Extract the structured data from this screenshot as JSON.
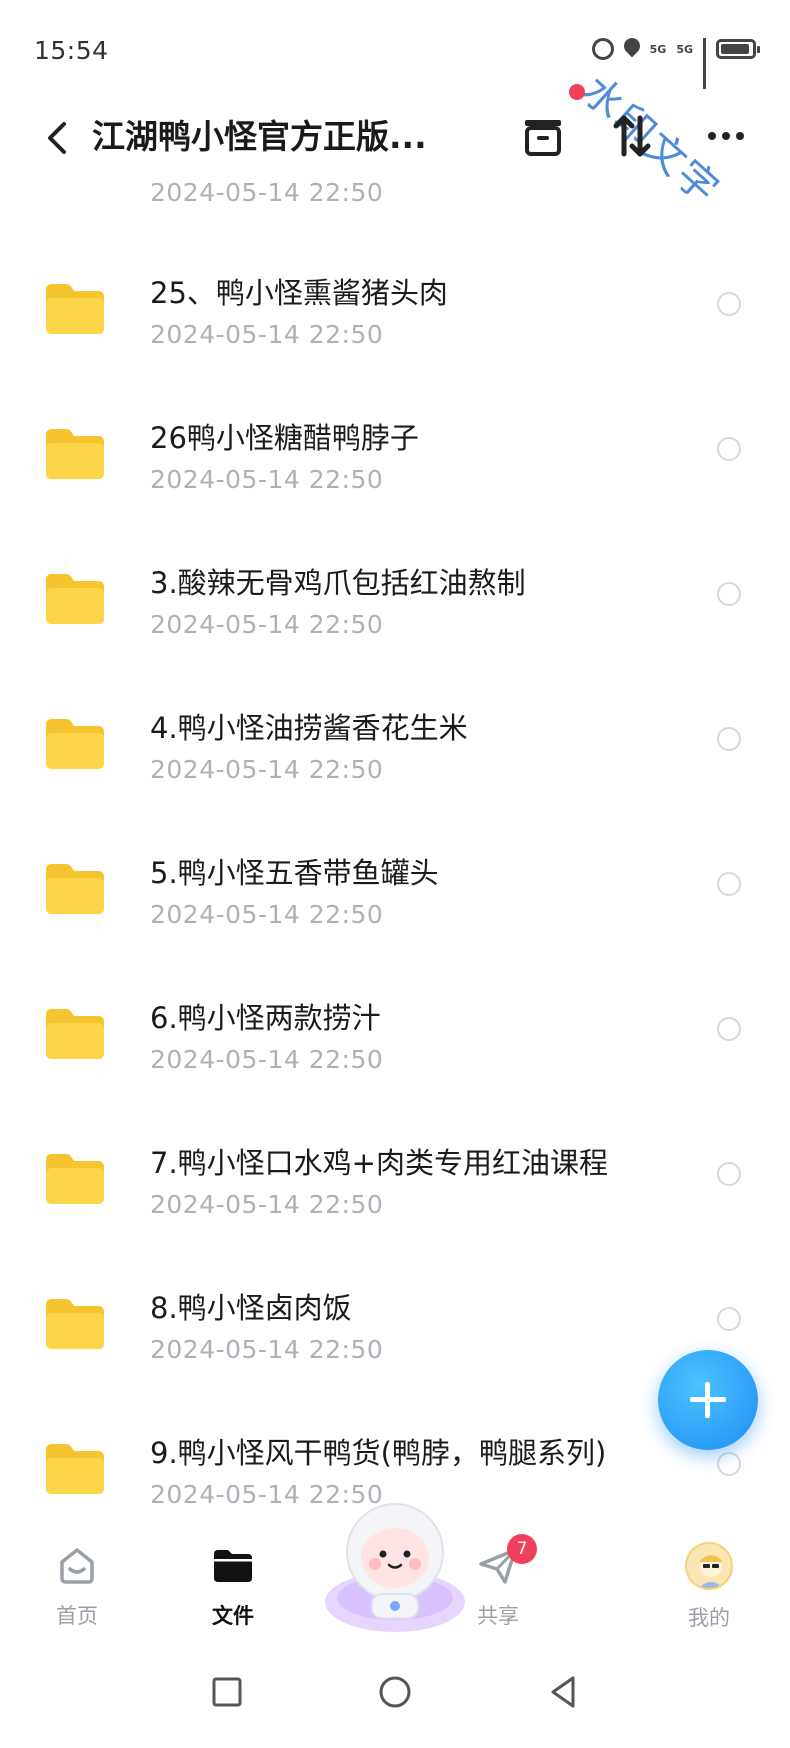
{
  "status_bar": {
    "time": "15:54",
    "signal_label_1": "5G",
    "signal_label_2": "5G"
  },
  "watermark": "水印文字",
  "header": {
    "title": "江湖鸭小怪官方正版..."
  },
  "partial_row": {
    "date": "2024-05-14  22:50"
  },
  "files": [
    {
      "name": "25、鸭小怪熏酱猪头肉",
      "date": "2024-05-14  22:50"
    },
    {
      "name": "26鸭小怪糖醋鸭脖子",
      "date": "2024-05-14  22:50"
    },
    {
      "name": "3.酸辣无骨鸡爪包括红油熬制",
      "date": "2024-05-14  22:50"
    },
    {
      "name": "4.鸭小怪油捞酱香花生米",
      "date": "2024-05-14  22:50"
    },
    {
      "name": "5.鸭小怪五香带鱼罐头",
      "date": "2024-05-14  22:50"
    },
    {
      "name": "6.鸭小怪两款捞汁",
      "date": "2024-05-14  22:50"
    },
    {
      "name": "7.鸭小怪口水鸡+肉类专用红油课程",
      "date": "2024-05-14  22:50"
    },
    {
      "name": "8.鸭小怪卤肉饭",
      "date": "2024-05-14  22:50"
    },
    {
      "name": "9.鸭小怪风干鸭货(鸭脖，鸭腿系列)",
      "date": "2024-05-14  22:50"
    }
  ],
  "bottom_nav": {
    "home": "首页",
    "files": "文件",
    "share": "共享",
    "share_badge": "7",
    "mine": "我的"
  },
  "colors": {
    "accent": "#1e8cf2",
    "badge": "#f0405c",
    "folder": "#f9cf3a",
    "muted_text": "#aeb1b8"
  }
}
